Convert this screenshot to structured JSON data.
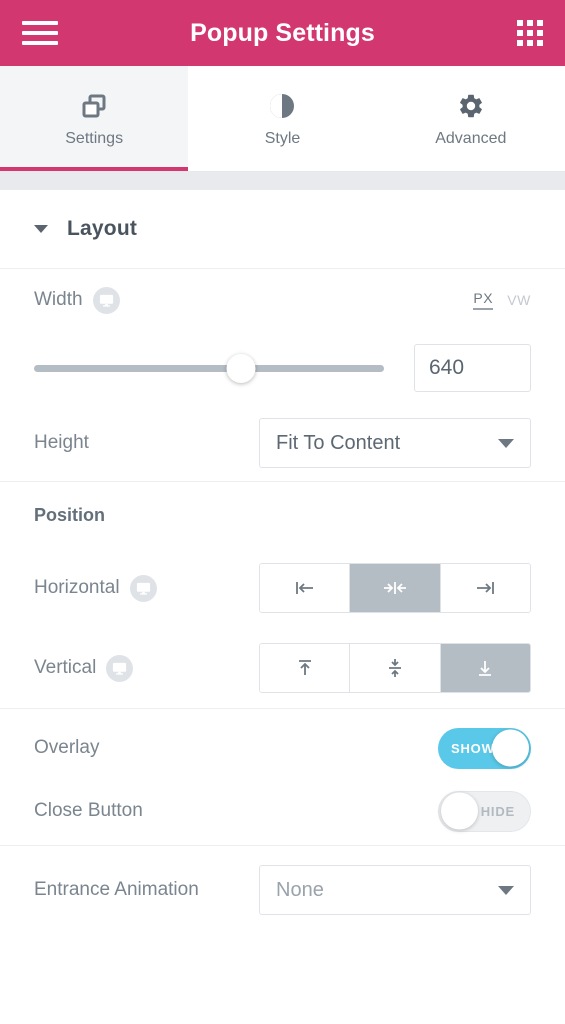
{
  "header": {
    "title": "Popup Settings",
    "menu_icon": "hamburger-menu-icon",
    "apps_icon": "grid-apps-icon"
  },
  "tabs": [
    {
      "label": "Settings",
      "icon": "overlapping-squares-icon",
      "active": true
    },
    {
      "label": "Style",
      "icon": "contrast-circle-icon",
      "active": false
    },
    {
      "label": "Advanced",
      "icon": "gear-icon",
      "active": false
    }
  ],
  "sections": {
    "layout": {
      "title": "Layout",
      "expanded": true,
      "caret_icon": "caret-down-icon"
    }
  },
  "controls": {
    "width": {
      "label": "Width",
      "responsive_icon": "desktop-monitor-icon",
      "units": [
        {
          "label": "PX",
          "active": true
        },
        {
          "label": "VW",
          "active": false
        }
      ],
      "value": "640",
      "slider_percent": 59
    },
    "height": {
      "label": "Height",
      "value": "Fit To Content",
      "caret_icon": "dropdown-caret-icon"
    },
    "position": {
      "title": "Position",
      "horizontal": {
        "label": "Horizontal",
        "responsive_icon": "desktop-monitor-icon",
        "options": [
          {
            "name": "align-left",
            "selected": false
          },
          {
            "name": "align-center",
            "selected": true
          },
          {
            "name": "align-right",
            "selected": false
          }
        ]
      },
      "vertical": {
        "label": "Vertical",
        "responsive_icon": "desktop-monitor-icon",
        "options": [
          {
            "name": "align-top",
            "selected": false
          },
          {
            "name": "align-middle",
            "selected": false
          },
          {
            "name": "align-bottom",
            "selected": true
          }
        ]
      }
    },
    "overlay": {
      "label": "Overlay",
      "state": "on",
      "state_label": "SHOW"
    },
    "close_button": {
      "label": "Close Button",
      "state": "off",
      "state_label": "HIDE"
    },
    "entrance_animation": {
      "label": "Entrance Animation",
      "value": "None",
      "caret_icon": "dropdown-caret-icon"
    }
  },
  "colors": {
    "brand_pink": "#d3376f",
    "toggle_on_blue": "#5ac8e8",
    "segment_active_gray": "#b4bcc4",
    "text_gray": "#7a858f"
  }
}
